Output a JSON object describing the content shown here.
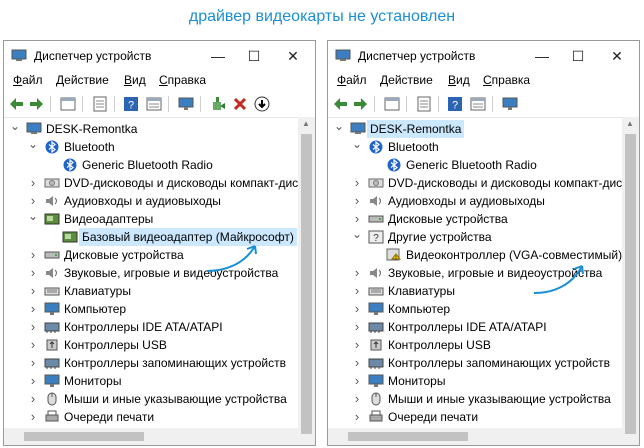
{
  "headline": "драйвер видеокарты не установлен",
  "windows": [
    {
      "title": "Диспетчер устройств",
      "menu": [
        "Файл",
        "Действие",
        "Вид",
        "Справка"
      ],
      "tree": [
        {
          "label": "DESK-Remontka",
          "level": 0,
          "arrow": "open",
          "icon": "computer-icon",
          "selected": false
        },
        {
          "label": "Bluetooth",
          "level": 1,
          "arrow": "open",
          "icon": "bluetooth-icon"
        },
        {
          "label": "Generic Bluetooth Radio",
          "level": 2,
          "arrow": "",
          "icon": "bluetooth-icon"
        },
        {
          "label": "DVD-дисководы и дисководы компакт-дис",
          "level": 1,
          "arrow": "closed",
          "icon": "dvd-drive-icon"
        },
        {
          "label": "Аудиовходы и аудиовыходы",
          "level": 1,
          "arrow": "closed",
          "icon": "speaker-icon"
        },
        {
          "label": "Видеоадаптеры",
          "level": 1,
          "arrow": "open",
          "icon": "display-adapter-icon"
        },
        {
          "label": "Базовый видеоадаптер (Майкрософт)",
          "level": 2,
          "arrow": "",
          "icon": "display-adapter-icon",
          "selected": true
        },
        {
          "label": "Дисковые устройства",
          "level": 1,
          "arrow": "closed",
          "icon": "disk-drive-icon"
        },
        {
          "label": "Звуковые, игровые и видеоустройства",
          "level": 1,
          "arrow": "closed",
          "icon": "speaker-icon"
        },
        {
          "label": "Клавиатуры",
          "level": 1,
          "arrow": "closed",
          "icon": "keyboard-icon"
        },
        {
          "label": "Компьютер",
          "level": 1,
          "arrow": "closed",
          "icon": "monitor-icon"
        },
        {
          "label": "Контроллеры IDE ATA/ATAPI",
          "level": 1,
          "arrow": "closed",
          "icon": "controller-icon"
        },
        {
          "label": "Контроллеры USB",
          "level": 1,
          "arrow": "closed",
          "icon": "usb-icon"
        },
        {
          "label": "Контроллеры запоминающих устройств",
          "level": 1,
          "arrow": "closed",
          "icon": "controller-icon"
        },
        {
          "label": "Мониторы",
          "level": 1,
          "arrow": "closed",
          "icon": "monitor-icon"
        },
        {
          "label": "Мыши и иные указывающие устройства",
          "level": 1,
          "arrow": "closed",
          "icon": "mouse-icon"
        },
        {
          "label": "Очереди печати",
          "level": 1,
          "arrow": "closed",
          "icon": "printer-icon"
        }
      ]
    },
    {
      "title": "Диспетчер устройств",
      "menu": [
        "Файл",
        "Действие",
        "Вид",
        "Справка"
      ],
      "tree": [
        {
          "label": "DESK-Remontka",
          "level": 0,
          "arrow": "open",
          "icon": "computer-icon",
          "selected": true
        },
        {
          "label": "Bluetooth",
          "level": 1,
          "arrow": "open",
          "icon": "bluetooth-icon"
        },
        {
          "label": "Generic Bluetooth Radio",
          "level": 2,
          "arrow": "",
          "icon": "bluetooth-icon"
        },
        {
          "label": "DVD-дисководы и дисководы компакт-дис",
          "level": 1,
          "arrow": "closed",
          "icon": "dvd-drive-icon"
        },
        {
          "label": "Аудиовходы и аудиовыходы",
          "level": 1,
          "arrow": "closed",
          "icon": "speaker-icon"
        },
        {
          "label": "Дисковые устройства",
          "level": 1,
          "arrow": "closed",
          "icon": "disk-drive-icon"
        },
        {
          "label": "Другие устройства",
          "level": 1,
          "arrow": "open",
          "icon": "unknown-device-icon"
        },
        {
          "label": "Видеоконтроллер (VGA-совместимый)",
          "level": 2,
          "arrow": "",
          "icon": "warning-device-icon"
        },
        {
          "label": "Звуковые, игровые и видеоустройства",
          "level": 1,
          "arrow": "closed",
          "icon": "speaker-icon"
        },
        {
          "label": "Клавиатуры",
          "level": 1,
          "arrow": "closed",
          "icon": "keyboard-icon"
        },
        {
          "label": "Компьютер",
          "level": 1,
          "arrow": "closed",
          "icon": "monitor-icon"
        },
        {
          "label": "Контроллеры IDE ATA/ATAPI",
          "level": 1,
          "arrow": "closed",
          "icon": "controller-icon"
        },
        {
          "label": "Контроллеры USB",
          "level": 1,
          "arrow": "closed",
          "icon": "usb-icon"
        },
        {
          "label": "Контроллеры запоминающих устройств",
          "level": 1,
          "arrow": "closed",
          "icon": "controller-icon"
        },
        {
          "label": "Мониторы",
          "level": 1,
          "arrow": "closed",
          "icon": "monitor-icon"
        },
        {
          "label": "Мыши и иные указывающие устройства",
          "level": 1,
          "arrow": "closed",
          "icon": "mouse-icon"
        },
        {
          "label": "Очереди печати",
          "level": 1,
          "arrow": "closed",
          "icon": "printer-icon"
        }
      ]
    }
  ],
  "colors": {
    "accent": "#1a8fd6",
    "selection": "#cce8ff",
    "annotation_arrow": "#1a8fd6"
  }
}
